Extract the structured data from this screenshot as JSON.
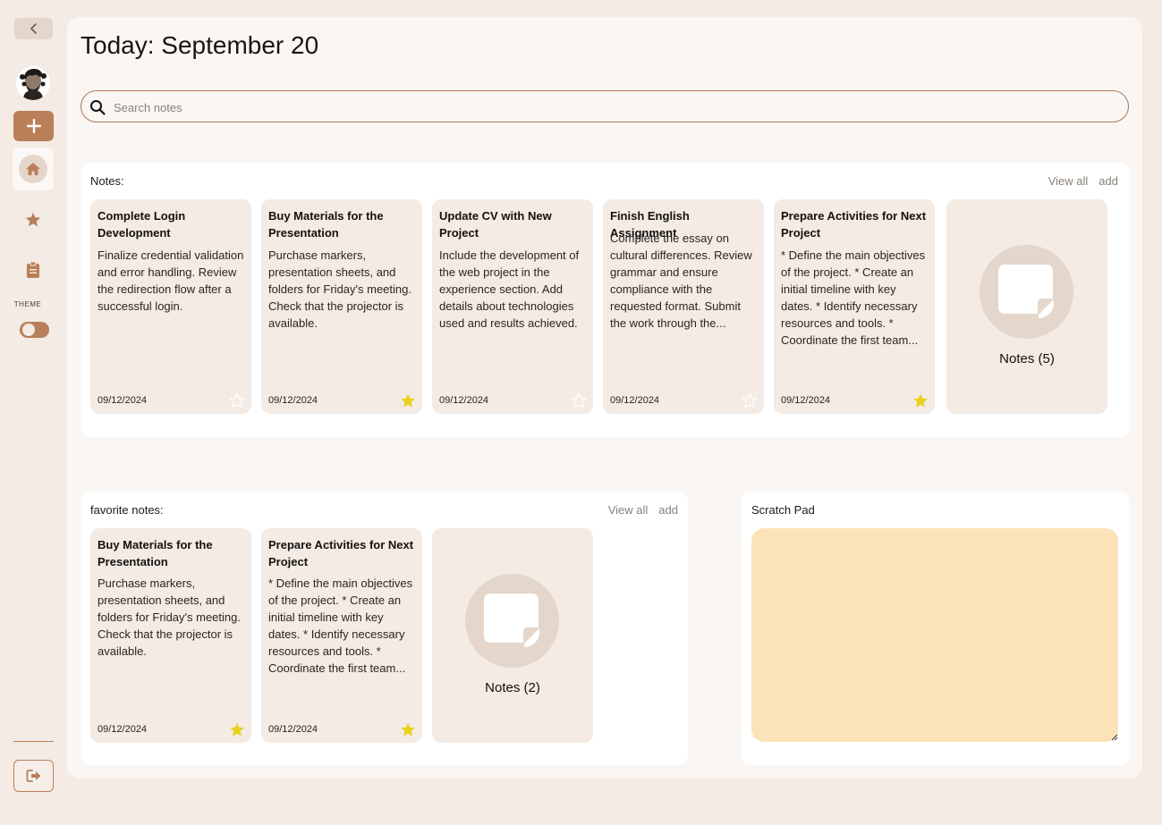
{
  "sidebar": {
    "theme_label": "THEME"
  },
  "header": {
    "title": "Today: September 20"
  },
  "search": {
    "placeholder": "Search notes",
    "value": ""
  },
  "notes_section": {
    "title": "Notes:",
    "view_all": "View all",
    "add": "add",
    "cards": [
      {
        "title": "Complete Login Development",
        "body": "Finalize credential validation and error handling. Review the redirection flow after a successful login.",
        "date": "09/12/2024",
        "favorite": false
      },
      {
        "title": "Buy Materials for the Presentation",
        "body": "Purchase markers, presentation sheets, and folders for Friday's meeting. Check that the projector is available.",
        "date": "09/12/2024",
        "favorite": true
      },
      {
        "title": "Update CV with New Project",
        "body": "Include the development of the web project in the experience section. Add details about technologies used and results achieved.",
        "date": "09/12/2024",
        "favorite": false
      },
      {
        "title": "Finish English Assignment",
        "body": "Complete the essay on cultural differences. Review grammar and ensure compliance with the requested format. Submit the work through the...",
        "date": "09/12/2024",
        "favorite": false
      },
      {
        "title": "Prepare Activities for Next Project",
        "body": "* Define the main objectives of the project. * Create an initial timeline with key dates. * Identify necessary resources and tools. * Coordinate the first team...",
        "date": "09/12/2024",
        "favorite": true
      }
    ],
    "more_label": "Notes (5)"
  },
  "favorites_section": {
    "title": "favorite notes:",
    "view_all": "View all",
    "add": "add",
    "cards": [
      {
        "title": "Buy Materials for the Presentation",
        "body": "Purchase markers, presentation sheets, and folders for Friday's meeting. Check that the projector is available.",
        "date": "09/12/2024",
        "favorite": true
      },
      {
        "title": "Prepare Activities for Next Project",
        "body": "* Define the main objectives of the project. * Create an initial timeline with key dates. * Identify necessary resources and tools. * Coordinate the first team...",
        "date": "09/12/2024",
        "favorite": true
      }
    ],
    "more_label": "Notes (2)"
  },
  "scratch_pad": {
    "title": "Scratch Pad",
    "value": ""
  },
  "colors": {
    "background": "#f3ebe4",
    "accent": "#b97f59",
    "card": "#f3ebe4",
    "star_filled": "#e8d21c",
    "scratch_pad": "#fbe3b7"
  },
  "icons": [
    "chevron-left-icon",
    "avatar",
    "plus-icon",
    "home-icon",
    "star-icon",
    "clipboard-icon",
    "toggle",
    "logout-icon",
    "search-icon",
    "sticky-note-icon"
  ]
}
